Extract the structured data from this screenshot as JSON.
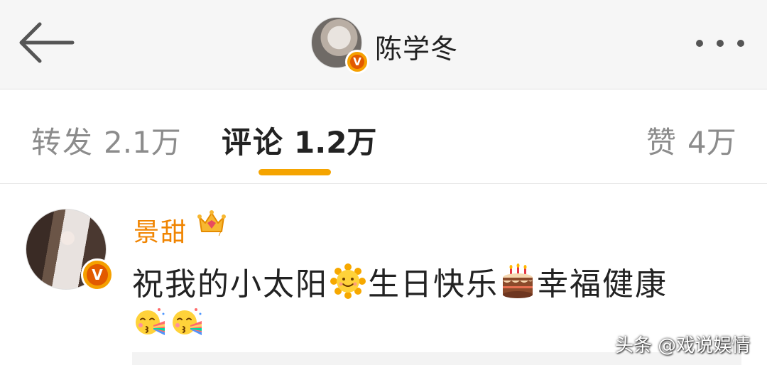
{
  "header": {
    "back_icon": "arrow-left-icon",
    "user_name": "陈学冬",
    "verified_badge": "V",
    "more_icon": "more-horizontal-icon"
  },
  "tabs": [
    {
      "label": "转发",
      "count": "2.1万",
      "active": false
    },
    {
      "label": "评论",
      "count": "1.2万",
      "active": true
    },
    {
      "label": "赞",
      "count": "4万",
      "active": false
    }
  ],
  "colors": {
    "accent": "#f5a400",
    "author": "#f08400",
    "verified": "#e25a00"
  },
  "comment": {
    "author": "景甜",
    "author_badge": "crown-icon",
    "verified_badge": "V",
    "text_parts": [
      "祝我的小太阳",
      "生日快乐",
      "幸福健康"
    ],
    "inline_icons": [
      "sun-emoji-icon",
      "cake-emoji-icon",
      "kiss-emoji-icon",
      "kiss-emoji-icon"
    ]
  },
  "watermark": "头条 @戏说娱情"
}
